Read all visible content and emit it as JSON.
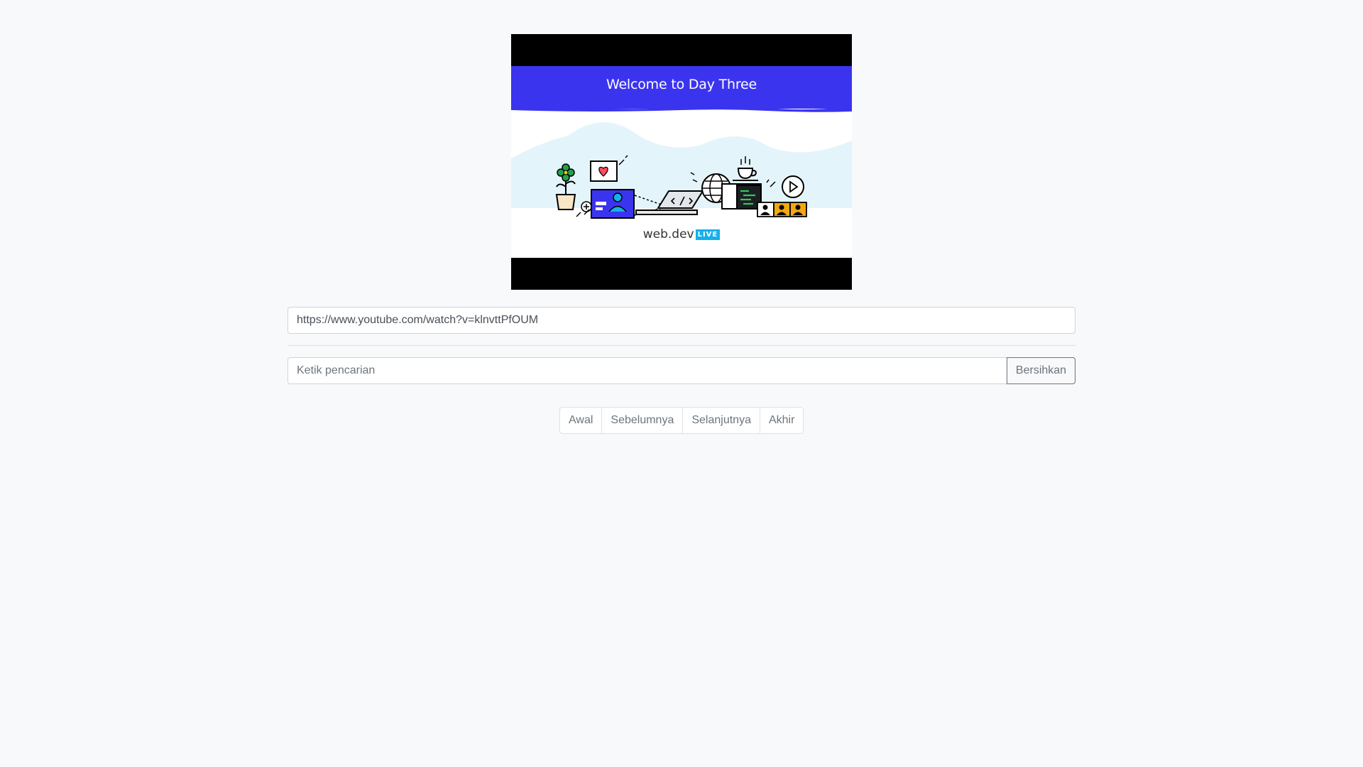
{
  "video": {
    "thumbnail_title": "Welcome to Day Three",
    "brand_name": "web.dev",
    "brand_badge": "LIVE",
    "colors": {
      "banner": "#3b34ee",
      "badge": "#14b0ee"
    }
  },
  "url_input": {
    "value": "https://www.youtube.com/watch?v=klnvttPfOUM"
  },
  "search": {
    "placeholder": "Ketik pencarian",
    "value": "",
    "clear_label": "Bersihkan"
  },
  "pagination": {
    "first_label": "Awal",
    "prev_label": "Sebelumnya",
    "next_label": "Selanjutnya",
    "last_label": "Akhir"
  }
}
